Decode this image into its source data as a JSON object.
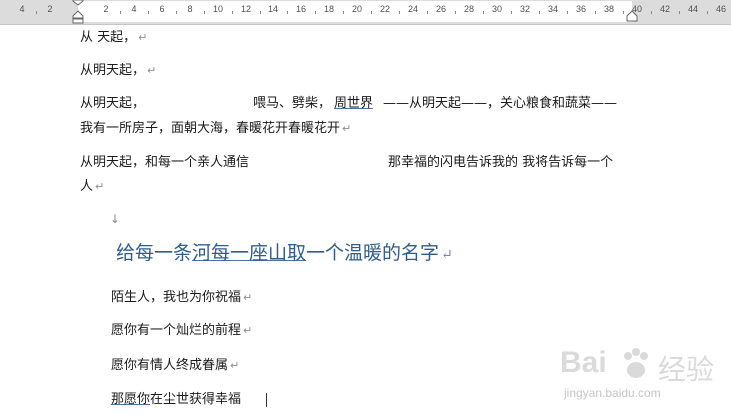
{
  "ruler": {
    "labels": [
      "4",
      "2",
      "2",
      "4",
      "6",
      "8",
      "10",
      "12",
      "14",
      "16",
      "18",
      "20",
      "22",
      "24",
      "26",
      "28",
      "30",
      "32",
      "34",
      "36",
      "38",
      "40",
      "42",
      "44",
      "46"
    ]
  },
  "doc": {
    "line1": {
      "text": "从  天起，"
    },
    "line2": {
      "text": "从明天起，"
    },
    "line3": {
      "a": "从明天起，",
      "b": "喂马、劈柴，",
      "c": "周世界",
      "d": "——从明天起——，关心粮食和蔬菜——"
    },
    "line4": {
      "text": "我有一所房子，面朝大海，春暖花开春暖花开"
    },
    "line5": {
      "a": "从明天起，和每一个亲人通信",
      "b": "那幸福的闪电告诉我的  我将告诉每一个"
    },
    "line6": {
      "text": "人"
    },
    "heading": {
      "a": "给每一条",
      "b": "河每一座山取",
      "c": "一个温暖的名字"
    },
    "p1": {
      "text": "陌生人，我也为你祝福"
    },
    "p2": {
      "text": "愿你有一个灿烂的前程"
    },
    "p3": {
      "text": "愿你有情人终成眷属"
    },
    "p4": {
      "a": "那愿你",
      "b": "在尘世获得幸福"
    },
    "paragraph_mark": "↵",
    "down_arrow": "↓"
  },
  "watermark": {
    "brand": "Bai",
    "brand_cn": "经验",
    "url": "jingyan.baidu.com"
  },
  "colors": {
    "heading": "#2f5d8c",
    "ruler_bg": "#dcdcdc",
    "underline": "#4f6fa8"
  }
}
